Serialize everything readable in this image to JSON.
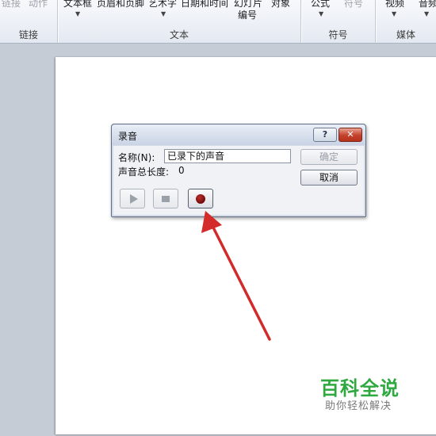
{
  "ribbon": {
    "items": [
      {
        "label": "链接",
        "disabled": true
      },
      {
        "label": "动作",
        "disabled": true
      },
      {
        "label": "文本框"
      },
      {
        "label": "页眉和页脚"
      },
      {
        "label": "艺术字"
      },
      {
        "label": "日期和时间"
      },
      {
        "label": "幻灯片"
      },
      {
        "label": "编号"
      },
      {
        "label": "对象"
      },
      {
        "label": "公式"
      },
      {
        "label": "符号",
        "disabled": true
      },
      {
        "label": "视频"
      },
      {
        "label": "音频"
      }
    ],
    "groups": [
      "链接",
      "文本",
      "符号",
      "媒体"
    ]
  },
  "dialog": {
    "title": "录音",
    "help": "?",
    "close": "✕",
    "name_label": "名称(N):",
    "name_value": "已录下的声音",
    "length_label": "声音总长度:",
    "length_value": "0",
    "ok_label": "确定",
    "cancel_label": "取消",
    "controls": [
      "play-icon",
      "stop-icon",
      "record-icon"
    ]
  },
  "watermark": {
    "title": "百科全说",
    "subtitle": "助你轻松解决"
  },
  "colors": {
    "record": "#8a1210",
    "arrow": "#d32a2a",
    "watermark": "#2ea83f"
  }
}
